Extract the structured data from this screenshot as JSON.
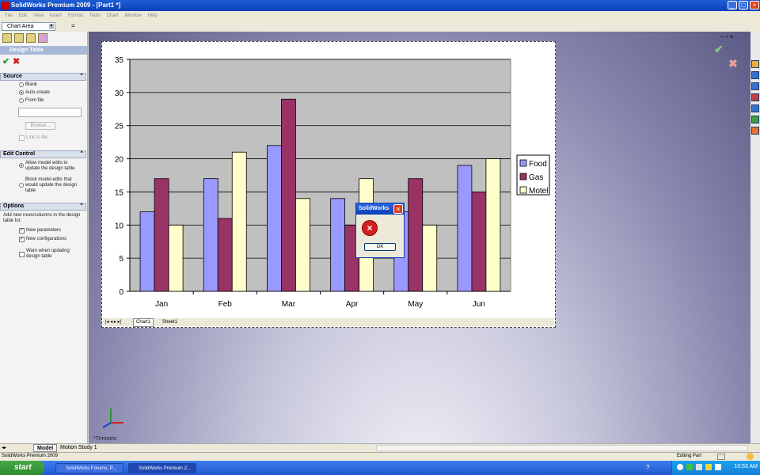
{
  "window": {
    "title": "SolidWorks Premium 2009 - [Part1 *]",
    "controls": [
      "_",
      "□",
      "×"
    ]
  },
  "menu": [
    "File",
    "Edit",
    "View",
    "Insert",
    "Format",
    "Tools",
    "Chart",
    "Window",
    "Help"
  ],
  "formula_bar": {
    "name_box": "Chart Area",
    "equals": "="
  },
  "panel": {
    "title": "Design Table",
    "source": {
      "header": "Source",
      "options": [
        "Blank",
        "Auto-create",
        "From file"
      ],
      "selected": "Auto-create",
      "browse_label": "Browse...",
      "link_label": "Link to file"
    },
    "edit_control": {
      "header": "Edit Control",
      "options": [
        "Allow model edits to update the design table",
        "Block model edits that would update the design table"
      ],
      "selected": "Allow model edits to update the design table"
    },
    "options": {
      "header": "Options",
      "intro": "Add new rows/columns in the design table for:",
      "checks": [
        {
          "label": "New parameters",
          "checked": true
        },
        {
          "label": "New configurations",
          "checked": true
        },
        {
          "label": "Warn when updating design table",
          "checked": false
        }
      ]
    }
  },
  "chart_data": {
    "type": "bar",
    "title": "",
    "xlabel": "",
    "ylabel": "",
    "categories": [
      "Jan",
      "Feb",
      "Mar",
      "Apr",
      "May",
      "Jun"
    ],
    "series": [
      {
        "name": "Food",
        "values": [
          12,
          17,
          22,
          14,
          12,
          19
        ],
        "color": "#9999ff"
      },
      {
        "name": "Gas",
        "values": [
          17,
          11,
          29,
          10,
          17,
          15
        ],
        "color": "#993366"
      },
      {
        "name": "Motel",
        "values": [
          10,
          21,
          14,
          17,
          10,
          20
        ],
        "color": "#ffffcc"
      }
    ],
    "ylim": [
      0,
      35
    ],
    "yticks": [
      0,
      5,
      10,
      15,
      20,
      25,
      30,
      35
    ],
    "grid": true,
    "plot_background": "#c0c0c0",
    "legend": "right"
  },
  "sheet_tabs": [
    "Chart1",
    "Sheet1"
  ],
  "dialog": {
    "title": "SolidWorks",
    "ok_label": "OK"
  },
  "view_label": "*Trimetric",
  "model_tabs": [
    "Model",
    "Motion Study 1"
  ],
  "status": {
    "left": "SolidWorks Premium 2009",
    "right": "Editing Part"
  },
  "taskbar": {
    "start": "start",
    "items": [
      "SolidWorks Forums: P...",
      "SolidWorks Premium 2..."
    ],
    "clock": "10:53 AM"
  }
}
